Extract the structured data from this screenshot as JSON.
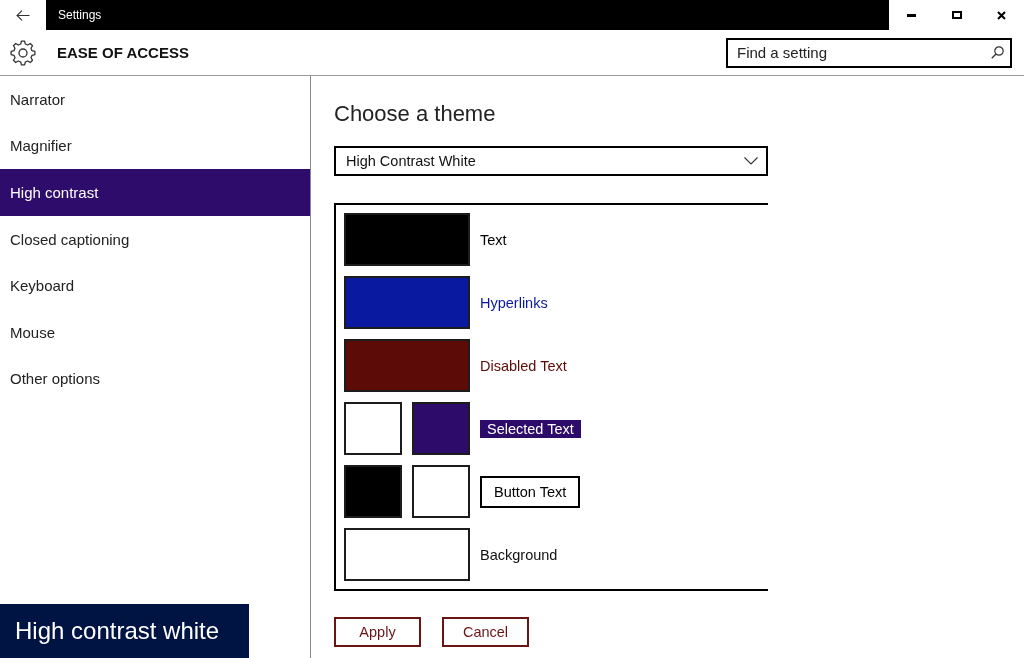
{
  "window": {
    "title": "Settings"
  },
  "header": {
    "title": "EASE OF ACCESS",
    "search": {
      "placeholder": "Find a setting"
    }
  },
  "sidebar": {
    "items": [
      {
        "label": "Narrator",
        "selected": false
      },
      {
        "label": "Magnifier",
        "selected": false
      },
      {
        "label": "High contrast",
        "selected": true
      },
      {
        "label": "Closed captioning",
        "selected": false
      },
      {
        "label": "Keyboard",
        "selected": false
      },
      {
        "label": "Mouse",
        "selected": false
      },
      {
        "label": "Other options",
        "selected": false
      }
    ]
  },
  "theme": {
    "heading": "Choose a theme",
    "dropdown": {
      "value": "High Contrast White"
    },
    "preview": [
      {
        "kind": "foreground",
        "label": "Text",
        "swatches": [
          {
            "color": "#000000"
          }
        ]
      },
      {
        "kind": "foreground",
        "label": "Hyperlinks",
        "swatches": [
          {
            "color": "#0a1aa0"
          }
        ]
      },
      {
        "kind": "foreground",
        "label": "Disabled Text",
        "swatches": [
          {
            "color": "#5c0b07"
          }
        ]
      },
      {
        "kind": "selection",
        "label": "Selected Text",
        "swatches": [
          {
            "color": "#ffffff"
          },
          {
            "color": "#2d0b6b"
          }
        ]
      },
      {
        "kind": "button",
        "label": "Button Text",
        "swatches": [
          {
            "color": "#000000"
          },
          {
            "color": "#ffffff"
          }
        ]
      },
      {
        "kind": "background",
        "label": "Background",
        "swatches": [
          {
            "color": "#ffffff"
          }
        ]
      }
    ],
    "buttons": [
      {
        "label": "Apply"
      },
      {
        "label": "Cancel"
      }
    ]
  },
  "caption": {
    "text": "High contrast white"
  }
}
